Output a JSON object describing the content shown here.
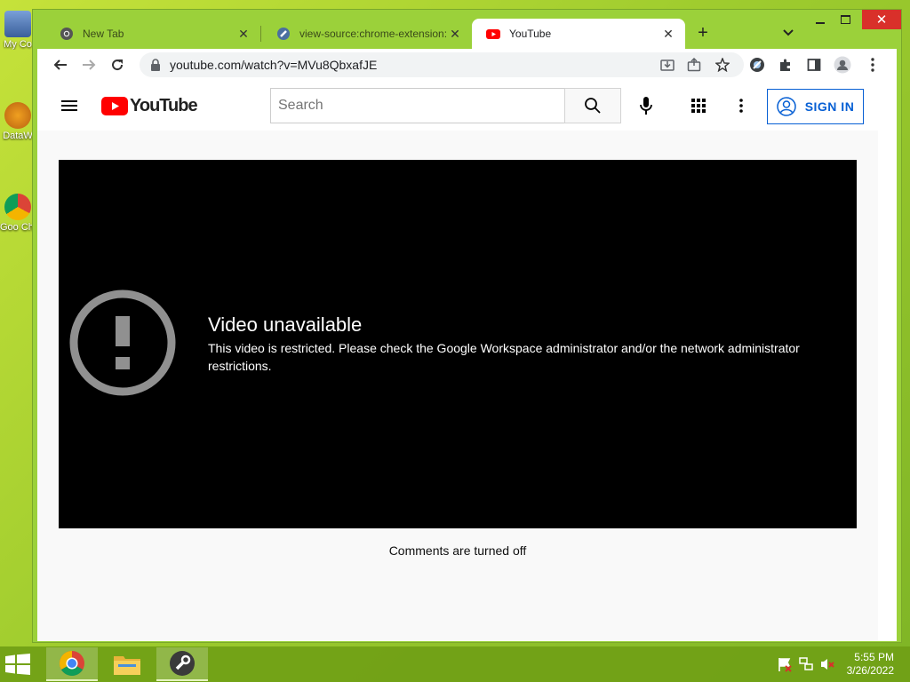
{
  "desktop": {
    "icons": [
      {
        "label": "My Co"
      },
      {
        "label": "DataW"
      },
      {
        "label": "Goo Chr"
      }
    ]
  },
  "browser": {
    "tabs": [
      {
        "title": "New Tab",
        "active": false
      },
      {
        "title": "view-source:chrome-extension://",
        "active": false
      },
      {
        "title": "YouTube",
        "active": true
      }
    ],
    "address": "youtube.com/watch?v=MVu8QbxafJE"
  },
  "youtube": {
    "logo_text": "YouTube",
    "search_placeholder": "Search",
    "sign_in_label": "SIGN IN",
    "error_title": "Video unavailable",
    "error_message": "This video is restricted. Please check the Google Workspace administrator and/or the network administrator restrictions.",
    "comments_status": "Comments are turned off"
  },
  "taskbar": {
    "time": "5:55 PM",
    "date": "3/26/2022"
  },
  "colors": {
    "youtube_red": "#ff0000",
    "sign_in_blue": "#065fd4",
    "desktop_green": "#9fcc2e",
    "close_red": "#d9302a"
  }
}
